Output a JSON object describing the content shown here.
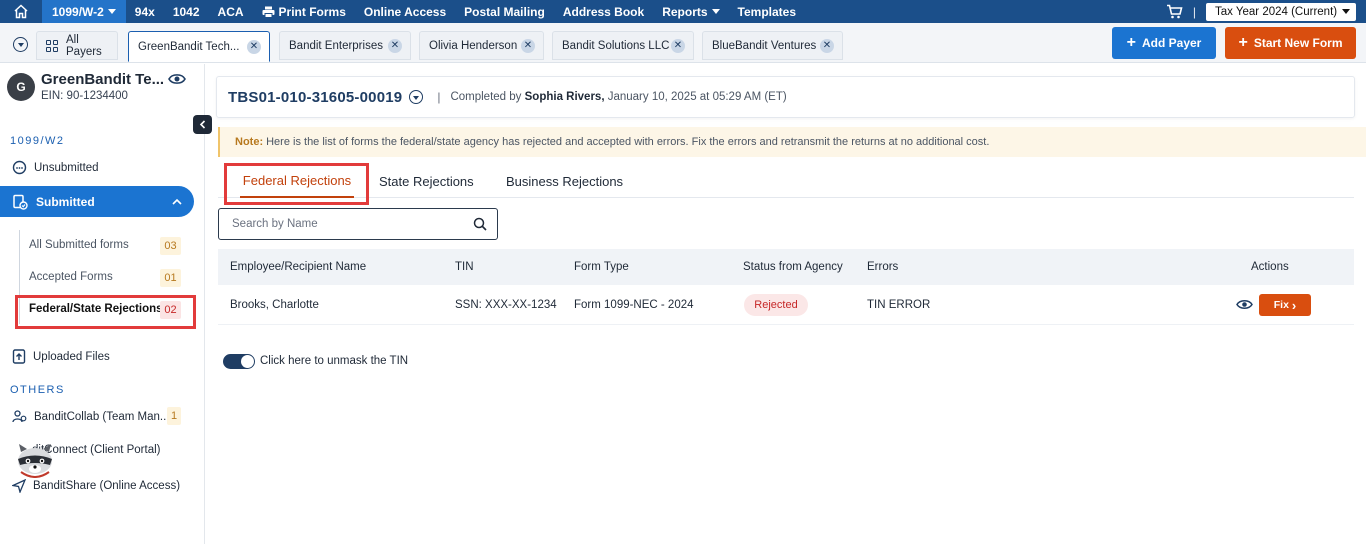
{
  "nav": {
    "active": "1099/W-2",
    "items": [
      "94x",
      "1042",
      "ACA",
      "Print Forms",
      "Online Access",
      "Postal Mailing",
      "Address Book",
      "Reports",
      "Templates"
    ],
    "separator": "|",
    "tax_year": "Tax Year 2024 (Current)"
  },
  "tabs": {
    "all_payers": "All Payers",
    "payers": [
      "GreenBandit Tech...",
      "Bandit Enterprises",
      "Olivia Henderson",
      "Bandit Solutions LLC",
      "BlueBandit Ventures"
    ],
    "close_glyph": "✕",
    "add_payer": "Add Payer",
    "start_new_form": "Start New Form",
    "plus": "+"
  },
  "sidebar": {
    "avatar_letter": "G",
    "payer_name": "GreenBandit Te...",
    "ein": "EIN: 90-1234400",
    "section_1099": "1099/W2",
    "unsubmitted": "Unsubmitted",
    "submitted": "Submitted",
    "sub_items": [
      {
        "label": "All Submitted forms",
        "count": "03"
      },
      {
        "label": "Accepted Forms",
        "count": "01"
      },
      {
        "label": "Federal/State Rejections",
        "count": "02"
      }
    ],
    "uploaded_files": "Uploaded Files",
    "section_others": "OTHERS",
    "collab": "BanditCollab (Team Man...",
    "collab_count": "1",
    "connect": "ditConnect (Client Portal)",
    "share": "BanditShare (Online Access)"
  },
  "main": {
    "submission_id": "TBS01-010-31605-00019",
    "separator": "|",
    "completed_by_prefix": "Completed by",
    "completed_by": "Sophia Rivers,",
    "completed_at": "January 10, 2025 at 05:29 AM (ET)",
    "note_label": "Note:",
    "note_text": "Here is the list of forms the federal/state agency has rejected and accepted with errors. Fix the errors and retransmit the returns at no additional cost.",
    "tabs": [
      "Federal Rejections",
      "State Rejections",
      "Business Rejections"
    ],
    "search_placeholder": "Search by Name",
    "table": {
      "headers": [
        "Employee/Recipient Name",
        "TIN",
        "Form Type",
        "Status from Agency",
        "Errors",
        "Actions"
      ],
      "rows": [
        {
          "name": "Brooks, Charlotte",
          "tin": "SSN: XXX-XX-1234",
          "form_type": "Form 1099-NEC - 2024",
          "status": "Rejected",
          "errors": "TIN ERROR",
          "action": "Fix",
          "action_glyph": "›"
        }
      ]
    },
    "toggle_label": "Click here to unmask the TIN"
  },
  "colors": {
    "nav_bg": "#1b4f8a",
    "primary": "#1b74d1",
    "accent": "#d94e0f",
    "highlight": "#e23b3b"
  }
}
